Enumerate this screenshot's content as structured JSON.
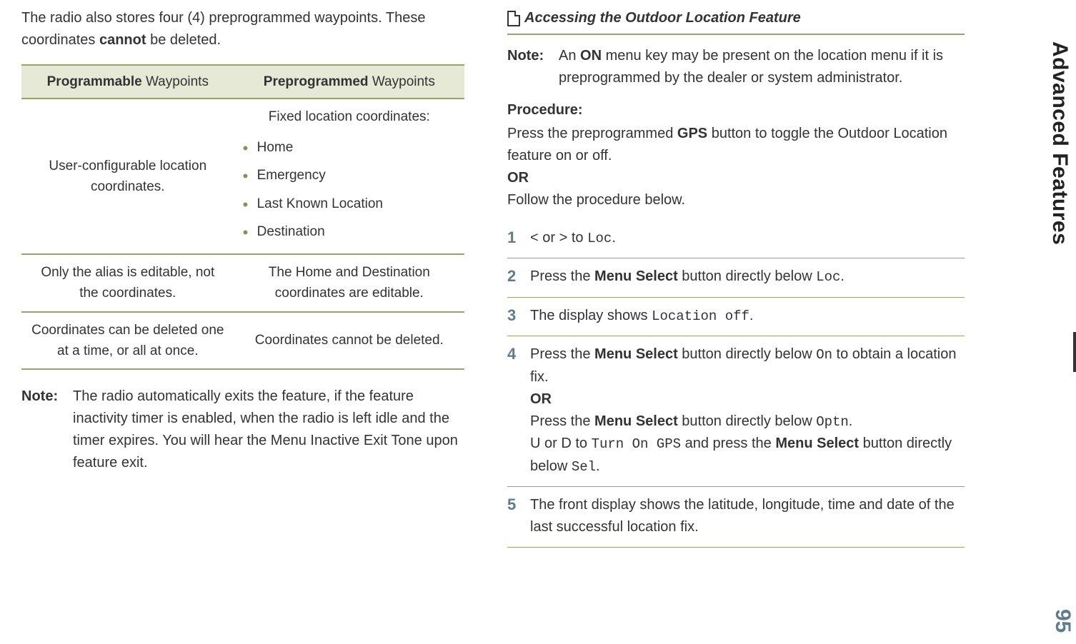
{
  "left": {
    "intro_pre": "The radio also stores four (4) preprogrammed waypoints. These coordinates ",
    "intro_bold": "cannot",
    "intro_post": " be deleted.",
    "table": {
      "header_left_bold": "Programmable",
      "header_left_rest": " Waypoints",
      "header_right_bold": "Preprogrammed",
      "header_right_rest": " Waypoints",
      "row1_left": "User-configurable location coordinates.",
      "row1_right_title": "Fixed location coordinates:",
      "row1_right_items": [
        "Home",
        "Emergency",
        "Last Known Location",
        "Destination"
      ],
      "row2_left": "Only the alias is editable, not the coordinates.",
      "row2_right": "The Home and Destination coordinates are editable.",
      "row3_left": "Coordinates can be deleted one at a time, or all at once.",
      "row3_right": "Coordinates cannot be deleted."
    },
    "note_label": "Note:",
    "note_text": "The radio automatically exits the feature, if the feature inactivity timer is enabled, when the radio is left idle and the timer expires. You will hear the Menu Inactive Exit Tone upon feature exit."
  },
  "right": {
    "section_title": "Accessing the Outdoor Location Feature",
    "note_label": "Note:",
    "note_pre": "An ",
    "note_bold": "ON",
    "note_post": " menu key may be present on the location menu if it is preprogrammed by the dealer or system administrator.",
    "proc_label": "Procedure:",
    "proc_intro_pre": "Press the preprogrammed ",
    "proc_intro_bold": "GPS",
    "proc_intro_post": " button to toggle the Outdoor Location feature on or off.",
    "or": "OR",
    "proc_follow": "Follow the procedure below.",
    "steps": {
      "s1_a": "< ",
      "s1_b": "or",
      "s1_c": " > ",
      "s1_d": "to ",
      "s1_code": "Loc",
      "s1_end": ".",
      "s2_pre": "Press the ",
      "s2_bold": "Menu Select",
      "s2_mid": " button directly below ",
      "s2_code": "Loc",
      "s2_end": ".",
      "s3_pre": "The display shows ",
      "s3_code": "Location off",
      "s3_end": ".",
      "s4_pre": "Press the ",
      "s4_bold": "Menu Select",
      "s4_mid": " button directly below ",
      "s4_code1": "On",
      "s4_post1": " to obtain a location fix.",
      "s4_or": "OR",
      "s4_pre2": "Press the ",
      "s4_bold2": "Menu Select",
      "s4_mid2": " button directly below ",
      "s4_code2": "Optn",
      "s4_end2": ".",
      "s4_line3a": "U ",
      "s4_line3b": "or ",
      "s4_line3c": "D ",
      "s4_line3d": "to ",
      "s4_code3": "Turn On GPS",
      "s4_line3e": " and press the ",
      "s4_bold3": "Menu Select",
      "s4_line3f": " button directly below ",
      "s4_code4": "Sel",
      "s4_end3": ".",
      "s5": "The front display shows the latitude, longitude, time and date of the last successful location fix."
    }
  },
  "side_text": "Advanced Features",
  "page_number": "95"
}
